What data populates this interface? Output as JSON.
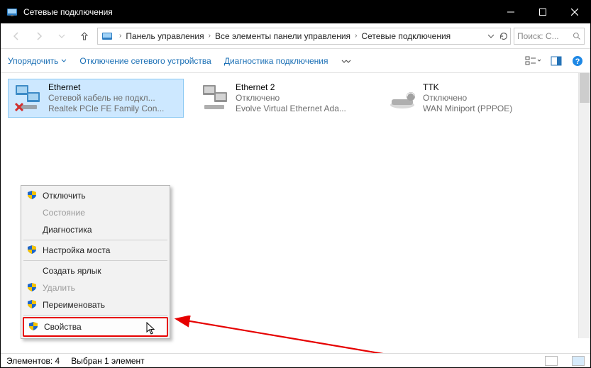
{
  "titlebar": {
    "title": "Сетевые подключения"
  },
  "breadcrumb": {
    "parts": [
      "Панель управления",
      "Все элементы панели управления",
      "Сетевые подключения"
    ]
  },
  "search": {
    "placeholder": "Поиск: С..."
  },
  "commandbar": {
    "organize": "Упорядочить",
    "disable": "Отключение сетевого устройства",
    "diag": "Диагностика подключения"
  },
  "adapters": [
    {
      "name": "Ethernet",
      "status": "Сетевой кабель не подкл...",
      "device": "Realtek PCIe FE Family Con...",
      "selected": true,
      "state": "down",
      "type": "nic"
    },
    {
      "name": "Ethernet 2",
      "status": "Отключено",
      "device": "Evolve Virtual Ethernet Ada...",
      "selected": false,
      "state": "disabled",
      "type": "nic"
    },
    {
      "name": "TTK",
      "status": "Отключено",
      "device": "WAN Miniport (PPPOE)",
      "selected": false,
      "state": "disabled",
      "type": "modem"
    }
  ],
  "context_menu": {
    "items": [
      {
        "label": "Отключить",
        "shield": true
      },
      {
        "label": "Состояние",
        "disabled": true
      },
      {
        "label": "Диагностика"
      },
      {
        "sep": true
      },
      {
        "label": "Настройка моста",
        "shield": true
      },
      {
        "sep": true
      },
      {
        "label": "Создать ярлык"
      },
      {
        "label": "Удалить",
        "shield": true,
        "disabled": true
      },
      {
        "label": "Переименовать",
        "shield": true
      },
      {
        "sep": true
      },
      {
        "label": "Свойства",
        "shield": true,
        "highlight": true
      }
    ]
  },
  "statusbar": {
    "count_label": "Элементов: 4",
    "sel_label": "Выбран 1 элемент"
  }
}
